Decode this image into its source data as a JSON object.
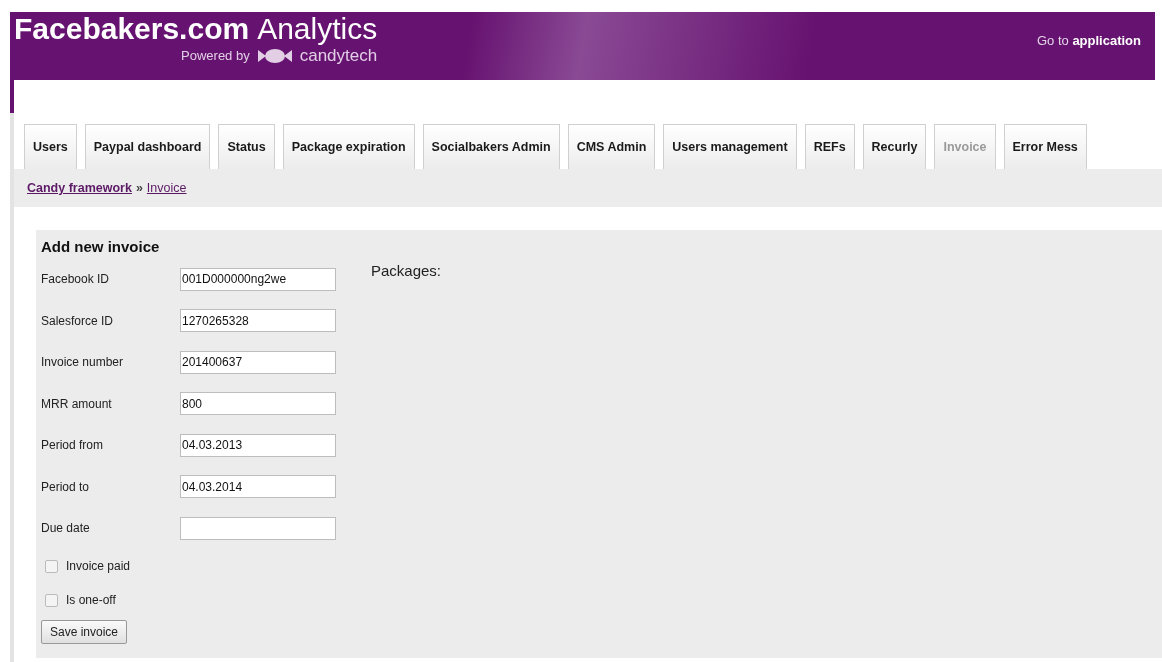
{
  "header": {
    "brand_bold": "Facebakers.com",
    "brand_light": "Analytics",
    "powered_by": "Powered by",
    "powered_brand": "candytech",
    "link_prefix": "Go to",
    "link_bold": "application"
  },
  "tabs": [
    {
      "label": "Users",
      "selected": false
    },
    {
      "label": "Paypal dashboard",
      "selected": false
    },
    {
      "label": "Status",
      "selected": false
    },
    {
      "label": "Package expiration",
      "selected": false
    },
    {
      "label": "Socialbakers Admin",
      "selected": false
    },
    {
      "label": "CMS Admin",
      "selected": false
    },
    {
      "label": "Users management",
      "selected": false
    },
    {
      "label": "REFs",
      "selected": false
    },
    {
      "label": "Recurly",
      "selected": false
    },
    {
      "label": "Invoice",
      "selected": true
    },
    {
      "label": "Error Mess",
      "selected": false
    }
  ],
  "breadcrumb": {
    "items": [
      "Candy framework",
      "Invoice"
    ],
    "separator": "»"
  },
  "form": {
    "title": "Add new invoice",
    "fields": [
      {
        "label": "Facebook ID",
        "value": "001D000000ng2we"
      },
      {
        "label": "Salesforce ID",
        "value": "1270265328"
      },
      {
        "label": "Invoice number",
        "value": "201400637"
      },
      {
        "label": "MRR amount",
        "value": "800"
      },
      {
        "label": "Period from",
        "value": "04.03.2013"
      },
      {
        "label": "Period to",
        "value": "04.03.2014"
      },
      {
        "label": "Due date"
      }
    ],
    "checkboxes": [
      {
        "label": "Invoice paid",
        "checked": false
      },
      {
        "label": "Is one-off",
        "checked": false
      }
    ],
    "submit": "Save invoice"
  },
  "packages": {
    "title": "Packages:"
  }
}
